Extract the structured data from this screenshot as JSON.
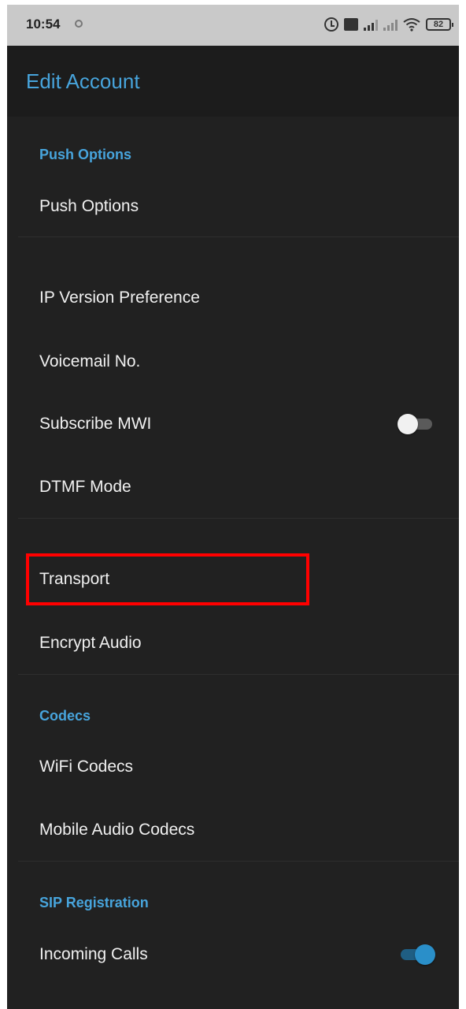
{
  "status_bar": {
    "time": "10:54",
    "battery": "82",
    "icons": [
      "notification-icon",
      "alarm-icon",
      "volte-icon",
      "signal-icon",
      "signal-icon",
      "wifi-icon",
      "battery-icon"
    ]
  },
  "app_bar": {
    "title": "Edit Account"
  },
  "sections": {
    "push": {
      "header": "Push Options",
      "items": [
        "Push Options"
      ]
    },
    "general": {
      "ip_version": "IP Version Preference",
      "voicemail": "Voicemail No.",
      "subscribe_mwi": "Subscribe MWI",
      "dtmf_mode": "DTMF Mode"
    },
    "transport": {
      "transport": "Transport",
      "encrypt_audio": "Encrypt Audio"
    },
    "codecs": {
      "header": "Codecs",
      "wifi": "WiFi Codecs",
      "mobile": "Mobile Audio Codecs"
    },
    "sip": {
      "header": "SIP Registration",
      "incoming_calls": "Incoming Calls"
    }
  },
  "toggles": {
    "subscribe_mwi": false,
    "incoming_calls": true
  },
  "colors": {
    "accent": "#47a4dc",
    "background": "#212121",
    "app_bar": "#1c1c1c",
    "status_bar": "#c9c9c9",
    "highlight": "#ff0000",
    "switch_on": "#2a8fc9"
  }
}
